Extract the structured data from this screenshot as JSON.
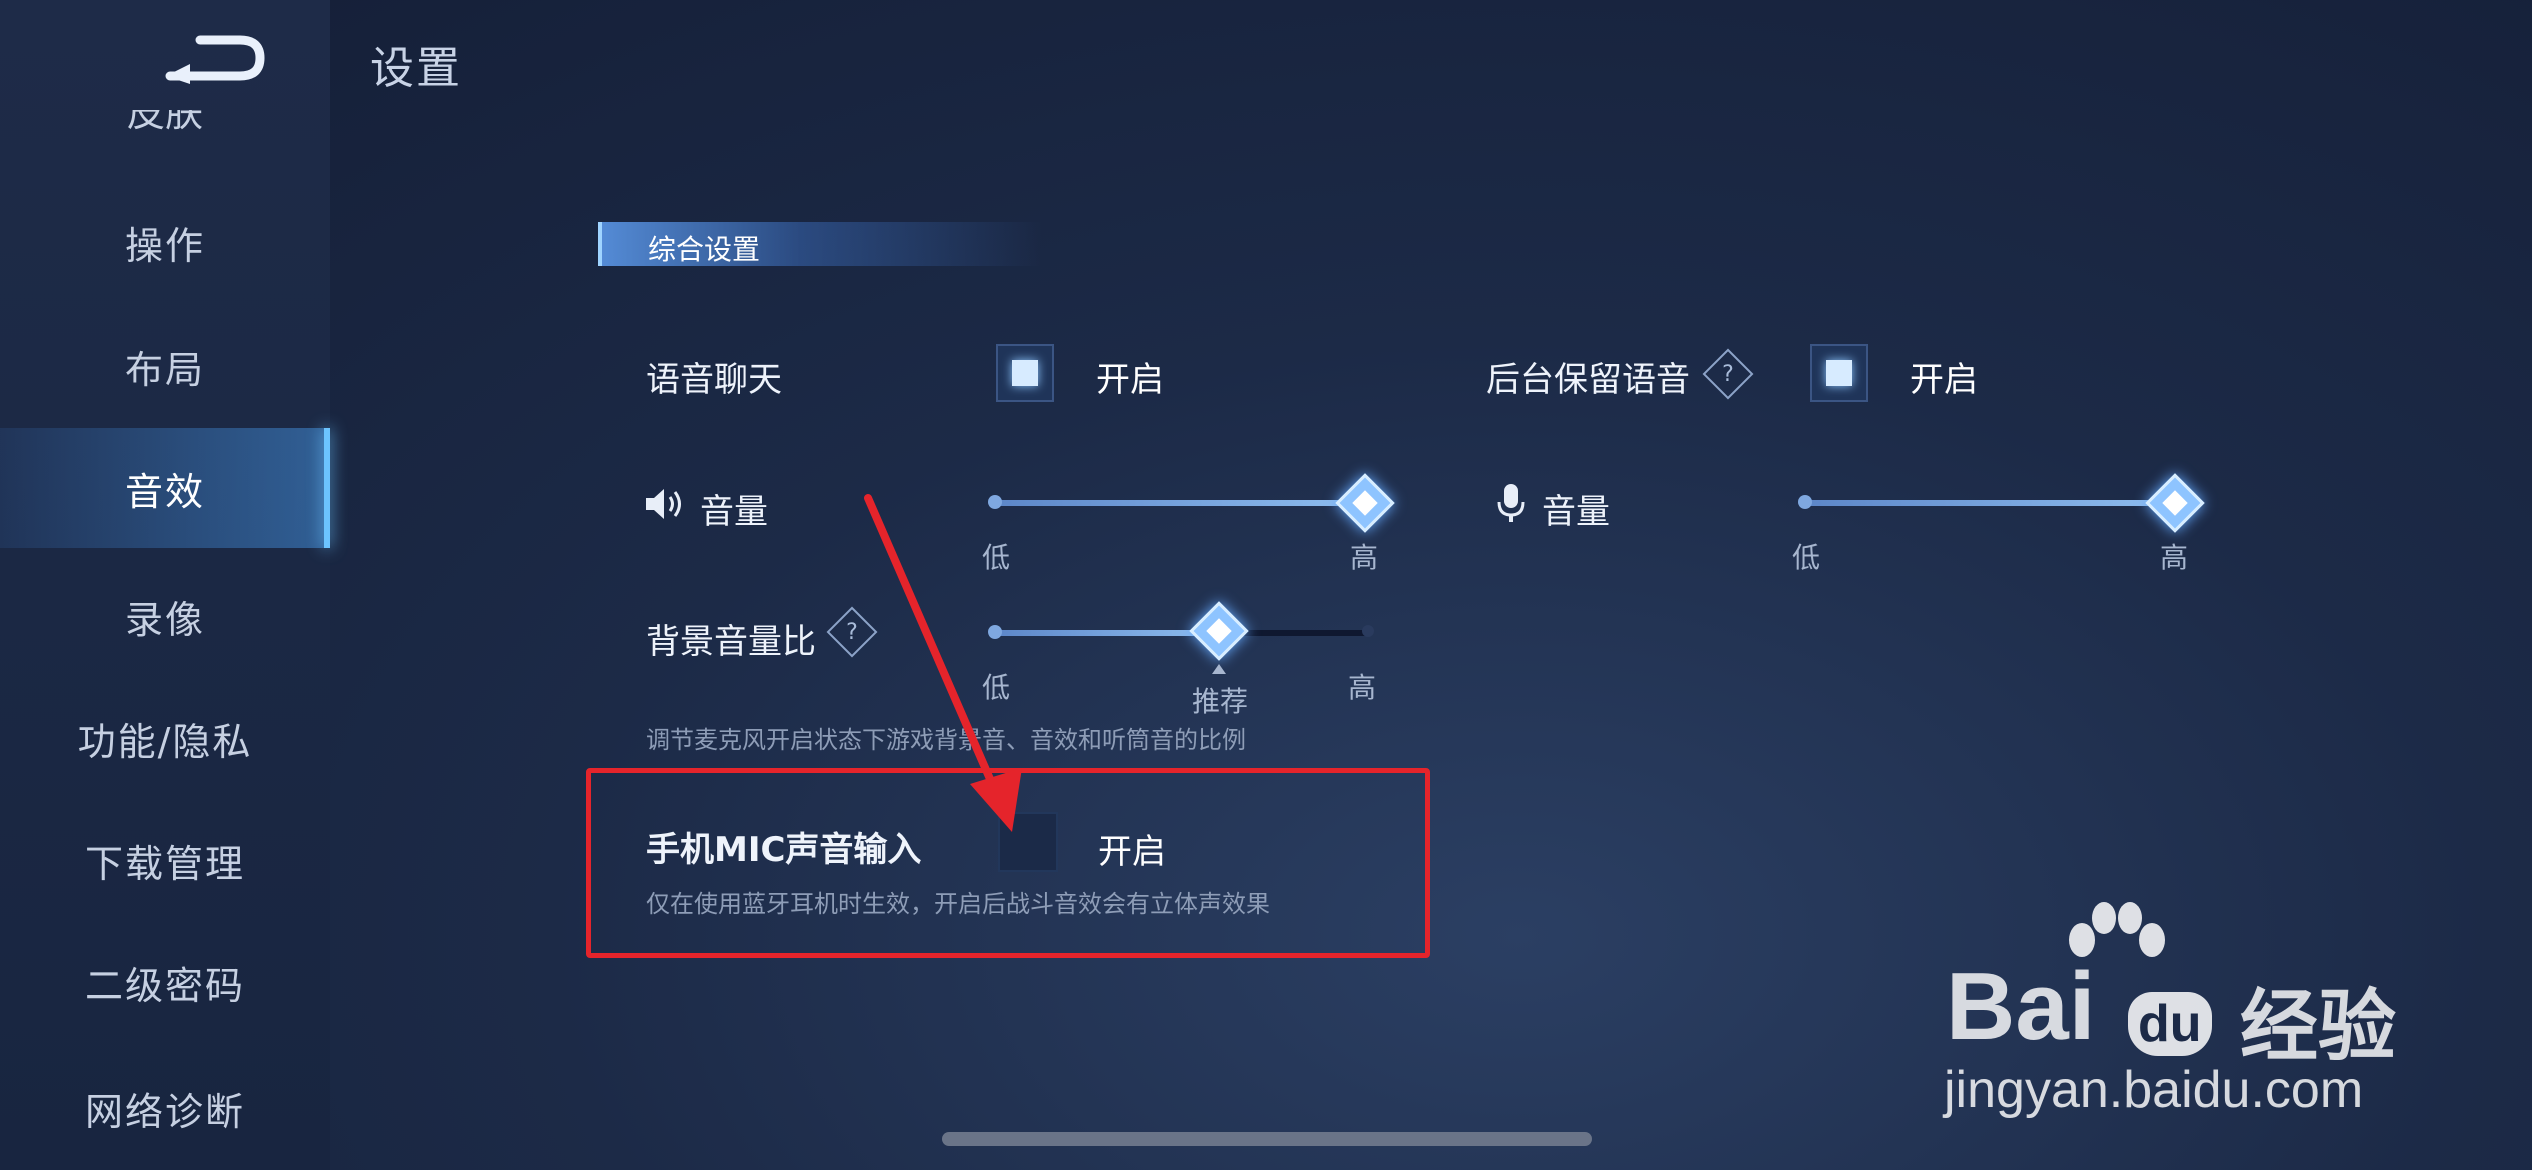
{
  "header": {
    "title": "设置"
  },
  "sidebar": {
    "partial_top": "皮肤",
    "items": [
      {
        "label": "操作"
      },
      {
        "label": "布局"
      },
      {
        "label": "音效",
        "active": true
      },
      {
        "label": "录像"
      },
      {
        "label": "功能/隐私"
      },
      {
        "label": "下载管理"
      },
      {
        "label": "二级密码"
      },
      {
        "label": "网络诊断"
      }
    ]
  },
  "section": {
    "title": "综合设置"
  },
  "settings": {
    "voice_chat": {
      "label": "语音聊天",
      "toggle_label": "开启",
      "checked": true
    },
    "bg_keep_voice": {
      "label": "后台保留语音",
      "toggle_label": "开启",
      "checked": true
    },
    "speaker_volume": {
      "label": "音量",
      "icon": "speaker-icon",
      "low": "低",
      "high": "高",
      "value": 1.0
    },
    "mic_volume": {
      "label": "音量",
      "icon": "microphone-icon",
      "low": "低",
      "high": "高",
      "value": 1.0
    },
    "bg_volume_ratio": {
      "label": "背景音量比",
      "low": "低",
      "high": "高",
      "recommended": "推荐",
      "value": 0.6,
      "description": "调节麦克风开启状态下游戏背景音、音效和听筒音的比例"
    },
    "phone_mic_input": {
      "label": "手机MIC声音输入",
      "toggle_label": "开启",
      "checked": false,
      "description": "仅在使用蓝牙耳机时生效，开启后战斗音效会有立体声效果"
    }
  },
  "watermark": {
    "brand": "Bai",
    "brand_suffix": "du",
    "product": "经验",
    "url": "jingyan.baidu.com"
  },
  "colors": {
    "highlight": "#e5242b",
    "accent": "#6cc4ff",
    "background": "#1c2a47"
  }
}
